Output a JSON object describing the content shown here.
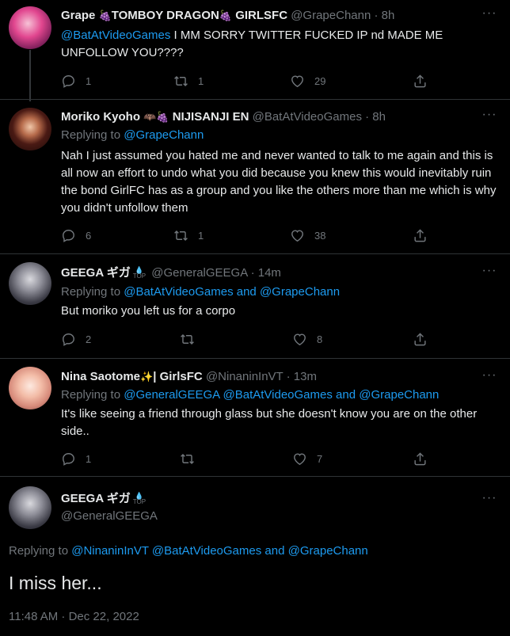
{
  "tweets": [
    {
      "name": "Grape",
      "name_emoji_1": "🍇",
      "name_mid": "TOMBOY DRAGON",
      "name_emoji_2": "🍇",
      "name_end": " GIRLSFC",
      "handle": "@GrapeChann",
      "sep": "·",
      "time": "8h",
      "text_mention": "@BatAtVideoGames",
      "text": " I MM SORRY TWITTER FUCKED IP nd MADE ME UNFOLLOW YOU????",
      "replies": "1",
      "retweets": "1",
      "likes": "29"
    },
    {
      "name": "Moriko Kyoho",
      "name_emoji_1": "🦇",
      "name_emoji_2": "🍇",
      "name_end": " NIJISANJI EN",
      "handle": "@BatAtVideoGames",
      "sep": "·",
      "time": "8h",
      "replying_prefix": "Replying to ",
      "replying_to": "@GrapeChann",
      "text": "Nah I just assumed you hated me and never wanted to talk to  me again and this is all now an effort to undo what you did because you knew this would inevitably ruin the bond GirlFC has as a group and you like the others more than me which is why you didn't unfollow them",
      "replies": "6",
      "retweets": "1",
      "likes": "38"
    },
    {
      "name": "GEEGA ギガ",
      "badge": "TOP",
      "handle": "@GeneralGEEGA",
      "sep": "·",
      "time": "14m",
      "replying_prefix": "Replying to ",
      "replying_to_1": "@BatAtVideoGames",
      "replying_and": " and ",
      "replying_to_2": "@GrapeChann",
      "text": "But moriko you left us for a corpo",
      "replies": "2",
      "retweets": "",
      "likes": "8"
    },
    {
      "name": "Nina Saotome",
      "name_emoji_1": "✨",
      "name_end": "| GirlsFC",
      "handle": "@NinaninInVT",
      "sep": "·",
      "time": "13m",
      "replying_prefix": "Replying to ",
      "replying_to_1": "@GeneralGEEGA",
      "replying_to_2": " @BatAtVideoGames",
      "replying_and": " and ",
      "replying_to_3": "@GrapeChann",
      "text": "It's like seeing a friend through glass but she doesn't know you are on the other side..",
      "replies": "1",
      "retweets": "",
      "likes": "7"
    }
  ],
  "main": {
    "name": "GEEGA ギガ",
    "badge": "TOP",
    "handle": "@GeneralGEEGA",
    "replying_prefix": "Replying to ",
    "replying_to_1": "@NinaninInVT",
    "replying_to_2": " @BatAtVideoGames",
    "replying_and": " and ",
    "replying_to_3": "@GrapeChann",
    "text": "I miss her...",
    "timestamp": "11:48 AM · Dec 22, 2022"
  },
  "icons": {
    "reply": "reply-icon",
    "retweet": "retweet-icon",
    "like": "heart-icon",
    "share": "share-icon",
    "more": "more-icon"
  },
  "colors": {
    "background": "#000000",
    "text": "#e7e9ea",
    "muted": "#71767b",
    "link": "#1d9bf0",
    "divider": "#2f3336"
  }
}
